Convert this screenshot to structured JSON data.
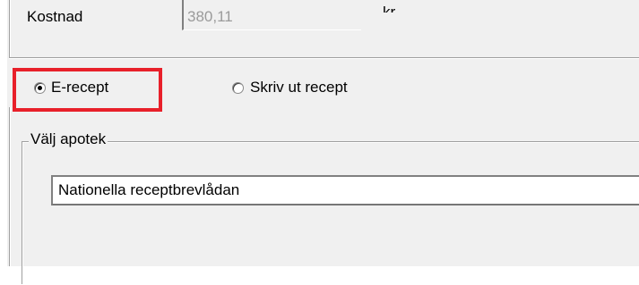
{
  "cost": {
    "label": "Kostnad",
    "value": "380,11",
    "unit": "kr"
  },
  "prescription_type": {
    "options": [
      {
        "label": "E-recept",
        "selected": true
      },
      {
        "label": "Skriv ut recept",
        "selected": false
      }
    ],
    "highlight_color": "#e8202a"
  },
  "pharmacy": {
    "group_title": "Välj apotek",
    "selected_value": "Nationella receptbrevlådan"
  }
}
